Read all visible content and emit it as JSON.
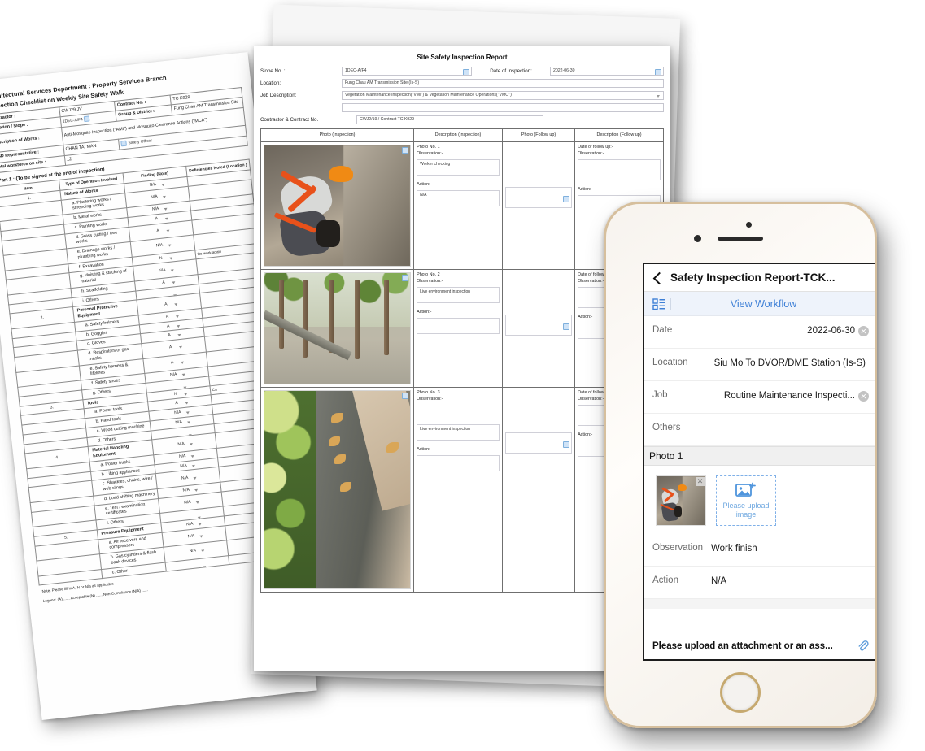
{
  "left_document": {
    "org_line": "Architectural Services Department : Property Services Branch",
    "form_title": "Inspection Checklist on Weekly Site Safety Walk",
    "header_fields": {
      "contractor_label": "Contractor :",
      "contractor_value": "CWJ29 JV",
      "contract_no_label": "Contract No. :",
      "contract_no_value": "TC K929",
      "location_slope_label": "Location / Slope :",
      "location_slope_value": "1DEC-A/F4",
      "group_district_label": "Group & District :",
      "group_district_value": "Fung Chau AM Transmission Site",
      "description_works_label": "Description of Works :",
      "description_works_value": "Anti-Mosquito Inspection (\"AMI\") and Mosquito Clearance Actions (\"MCA\")",
      "asd_rep_label": "ASD Representative :",
      "asd_rep_value": "CHAN TAI MAN",
      "asd_rep_role": "Safety Officer",
      "workforce_label": "Total workforce on site :",
      "workforce_value": "12"
    },
    "part_title": "Part 1 : (To be signed at the end of inspection)",
    "columns": [
      "Item",
      "Type of Operation Involved",
      "Finding (Note)",
      "Deficiencies Noted (Location )"
    ],
    "rows": [
      {
        "item": "1.",
        "type": "Nature of Works",
        "group": true,
        "finding": "N/A",
        "def": ""
      },
      {
        "item": "",
        "type": "a. Plastering works / screeding works",
        "group": false,
        "finding": "N/A",
        "def": ""
      },
      {
        "item": "",
        "type": "b. Metal works",
        "group": false,
        "finding": "N/A",
        "def": ""
      },
      {
        "item": "",
        "type": "c. Painting works",
        "group": false,
        "finding": "A",
        "def": ""
      },
      {
        "item": "",
        "type": "d. Grass cutting / tree works",
        "group": false,
        "finding": "A",
        "def": ""
      },
      {
        "item": "",
        "type": "e. Drainage works / plumbing works",
        "group": false,
        "finding": "N/A",
        "def": ""
      },
      {
        "item": "",
        "type": "f. Excavation",
        "group": false,
        "finding": "N",
        "def": "Re-work again"
      },
      {
        "item": "",
        "type": "g. Hoisting & stacking of material",
        "group": false,
        "finding": "N/A",
        "def": ""
      },
      {
        "item": "",
        "type": "h. Scaffolding",
        "group": false,
        "finding": "A",
        "def": ""
      },
      {
        "item": "",
        "type": "i. Others",
        "group": false,
        "finding": "",
        "def": ""
      },
      {
        "item": "2.",
        "type": "Personal Protective Equipment",
        "group": true,
        "finding": "A",
        "def": ""
      },
      {
        "item": "",
        "type": "a. Safety helmets",
        "group": false,
        "finding": "A",
        "def": ""
      },
      {
        "item": "",
        "type": "b. Goggles",
        "group": false,
        "finding": "A",
        "def": ""
      },
      {
        "item": "",
        "type": "c. Gloves",
        "group": false,
        "finding": "A",
        "def": ""
      },
      {
        "item": "",
        "type": "d. Respirators or gas masks",
        "group": false,
        "finding": "A",
        "def": ""
      },
      {
        "item": "",
        "type": "e. Safety harness & lifelines",
        "group": false,
        "finding": "A",
        "def": ""
      },
      {
        "item": "",
        "type": "f. Safety shoes",
        "group": false,
        "finding": "N/A",
        "def": ""
      },
      {
        "item": "",
        "type": "g. Others",
        "group": false,
        "finding": "",
        "def": ""
      },
      {
        "item": "3.",
        "type": "Tools",
        "group": true,
        "finding": "N",
        "def": "Ca"
      },
      {
        "item": "",
        "type": "a. Power tools",
        "group": false,
        "finding": "A",
        "def": ""
      },
      {
        "item": "",
        "type": "b. Hand tools",
        "group": false,
        "finding": "N/A",
        "def": ""
      },
      {
        "item": "",
        "type": "c. Wood cutting machine",
        "group": false,
        "finding": "N/A",
        "def": ""
      },
      {
        "item": "",
        "type": "d. Others",
        "group": false,
        "finding": "",
        "def": ""
      },
      {
        "item": "4.",
        "type": "Material Handling Equipment",
        "group": true,
        "finding": "N/A",
        "def": ""
      },
      {
        "item": "",
        "type": "a. Power trucks",
        "group": false,
        "finding": "N/A",
        "def": ""
      },
      {
        "item": "",
        "type": "b. Lifting appliances",
        "group": false,
        "finding": "N/A",
        "def": ""
      },
      {
        "item": "",
        "type": "c. Shackles, chains, wire / web slings",
        "group": false,
        "finding": "N/A",
        "def": ""
      },
      {
        "item": "",
        "type": "d. Load shifting machinery",
        "group": false,
        "finding": "N/A",
        "def": ""
      },
      {
        "item": "",
        "type": "e. Test / examination certificates",
        "group": false,
        "finding": "N/A",
        "def": ""
      },
      {
        "item": "",
        "type": "f. Others",
        "group": false,
        "finding": "",
        "def": ""
      },
      {
        "item": "5.",
        "type": "Pressure Equipment",
        "group": true,
        "finding": "N/A",
        "def": ""
      },
      {
        "item": "",
        "type": "a. Air receivers and compressors",
        "group": false,
        "finding": "N/A",
        "def": ""
      },
      {
        "item": "",
        "type": "b. Gas cylinders & flash back devices",
        "group": false,
        "finding": "N/A",
        "def": ""
      },
      {
        "item": "",
        "type": "c. Other",
        "group": false,
        "finding": "",
        "def": ""
      }
    ],
    "note_line1": "Note: Please fill in A, N or N/a as applicable",
    "note_line2": "Legend: (A) ......  Acceptable        (N) ......  Non-Compliance        (N/A) ......"
  },
  "mid_document": {
    "title": "Site Safety Inspection Report",
    "fields": {
      "slope_no_label": "Slope No. :",
      "slope_no_value": "1DEC-A/F4",
      "date_label": "Date of Inspection:",
      "date_value": "2022-06-30",
      "location_label": "Location:",
      "location_value": "Fung Chau AM Transmission Site (Is-S)",
      "job_desc_label": "Job Description:",
      "job_desc_value": "Vegetation Maintenance Inspection(\"VMI\") & Vegetation Maintenance Operations(\"VMO\")",
      "job_desc_extra": "",
      "contractor_label": "Contractor & Contract No.",
      "contractor_value": "CWJ2/19 / Contract TC K929"
    },
    "table_headers": [
      "Photo (Inspection)",
      "Description (Inspection)",
      "Photo (Follow up)",
      "Description (Follow up)"
    ],
    "rows": [
      {
        "photo_no": "Photo No. 1",
        "observation_label": "Observation:-",
        "observation_value": "Worker checking",
        "action_label": "Action:-",
        "action_value": "N/A",
        "fu_date_label": "Date of follow up:-",
        "fu_observation_label": "Observation:-",
        "fu_action_label": "Action:-"
      },
      {
        "photo_no": "Photo No. 2",
        "observation_label": "Observation:-",
        "observation_value": "Live environment inspection",
        "action_label": "Action:-",
        "action_value": "",
        "fu_date_label": "Date of follow up:-",
        "fu_observation_label": "Observation:-",
        "fu_action_label": "Action:-"
      },
      {
        "photo_no": "Photo No. 3",
        "observation_label": "Observation:-",
        "observation_value": "Live environment inspection",
        "action_label": "Action:-",
        "action_value": "",
        "fu_date_label": "Date of follow up:-",
        "fu_observation_label": "Observation:-",
        "fu_action_label": "Action:-"
      }
    ]
  },
  "phone": {
    "app_title": "Safety Inspection Report-TCK...",
    "workflow_label": "View Workflow",
    "fields": [
      {
        "key": "Date",
        "value": "2022-06-30",
        "clearable": true
      },
      {
        "key": "Location",
        "value": "Siu Mo To DVOR/DME Station (Is-S)",
        "clearable": false
      },
      {
        "key": "Job",
        "value": "Routine Maintenance Inspecti...",
        "clearable": true
      },
      {
        "key": "Others",
        "value": "",
        "clearable": false
      }
    ],
    "photo_section_title": "Photo 1",
    "upload_label": "Please upload image",
    "observation_key": "Observation",
    "observation_value": "Work finish",
    "action_key": "Action",
    "action_value": "N/A",
    "attachment_text": "Please upload an attachment or an ass..."
  },
  "colors": {
    "accent_blue": "#3d7fd6",
    "upload_blue": "#6fa8e0",
    "workflow_bar": "#eef3fb",
    "phone_frame_gold": "#d6bf9d",
    "helmet_orange": "#f08a14",
    "harness_orange": "#e8511a"
  }
}
